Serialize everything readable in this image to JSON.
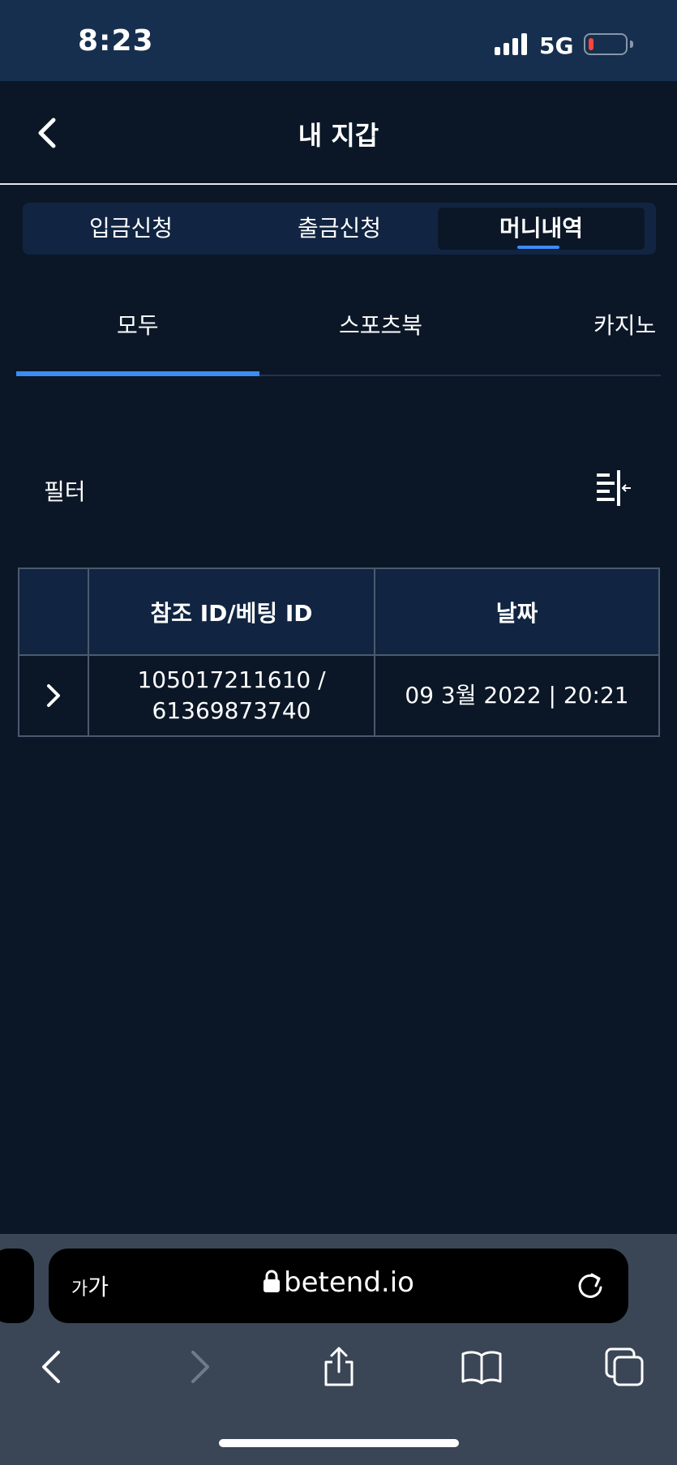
{
  "status_bar": {
    "time": "8:23",
    "network": "5G",
    "battery_percent": 12
  },
  "header": {
    "title": "내 지갑"
  },
  "main_tabs": [
    {
      "label": "입금신청",
      "active": false
    },
    {
      "label": "출금신청",
      "active": false
    },
    {
      "label": "머니내역",
      "active": true
    }
  ],
  "sub_tabs": [
    {
      "label": "모두",
      "active": true
    },
    {
      "label": "스포츠북",
      "active": false
    },
    {
      "label": "카지노",
      "active": false
    }
  ],
  "filter": {
    "label": "필터"
  },
  "table": {
    "columns": [
      "",
      "참조 ID/베팅 ID",
      "날짜"
    ],
    "rows": [
      {
        "ref_line1": "105017211610 /",
        "ref_line2": "61369873740",
        "date": "09 3월 2022 | 20:21"
      }
    ]
  },
  "browser": {
    "text_size_label_small": "가",
    "text_size_label_large": "가",
    "url": "betend.io"
  },
  "icons": {
    "back": "chevron-left-icon",
    "filter": "filter-align-icon",
    "expand": "chevron-right-icon",
    "lock": "lock-icon",
    "reload": "reload-icon",
    "toolbar": [
      "back-icon",
      "forward-icon",
      "share-icon",
      "bookmarks-icon",
      "tabs-icon"
    ]
  },
  "colors": {
    "background": "#0b1727",
    "panel": "#112542",
    "accent": "#3c8cf5",
    "status_bar": "#162f4e",
    "browser_bar": "#3a4656"
  }
}
